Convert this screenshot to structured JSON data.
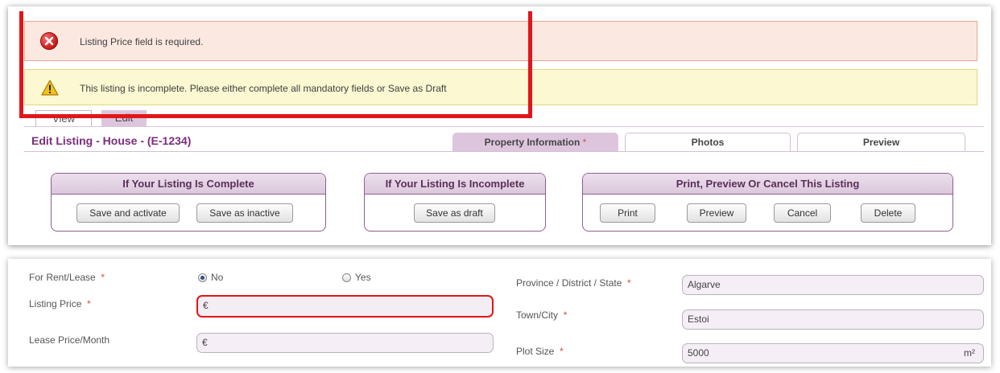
{
  "alerts": {
    "error": "Listing Price field is required.",
    "warning": "This listing is incomplete. Please either complete all mandatory fields or Save as Draft"
  },
  "mode_tabs": [
    "View",
    "Edit"
  ],
  "page_title": "Edit Listing - House - (E-1234)",
  "section_tabs": [
    {
      "label": "Property Information",
      "required": "*"
    },
    {
      "label": "Photos"
    },
    {
      "label": "Preview"
    }
  ],
  "groups": [
    {
      "title": "If Your Listing Is Complete",
      "buttons": [
        "Save and activate",
        "Save as inactive"
      ]
    },
    {
      "title": "If Your Listing Is Incomplete",
      "buttons": [
        "Save as draft"
      ]
    },
    {
      "title": "Print, Preview Or Cancel This Listing",
      "buttons": [
        "Print",
        "Preview",
        "Cancel",
        "Delete"
      ]
    }
  ],
  "form": {
    "rent_label": "For Rent/Lease",
    "rent_options": [
      "No",
      "Yes"
    ],
    "rent_selected": "No",
    "listing_price_label": "Listing Price",
    "listing_price_prefix": "€",
    "lease_price_label": "Lease Price/Month",
    "lease_price_prefix": "€",
    "province_label": "Province / District / State",
    "province_value": "Algarve",
    "town_label": "Town/City",
    "town_value": "Estoi",
    "plot_label": "Plot Size",
    "plot_value": "5000",
    "plot_unit": "m²",
    "required_mark": "*"
  },
  "colors": {
    "accent": "#7b2d7b",
    "tab_active": "#ddc6dd",
    "error_bg": "#fbe9e1",
    "warn_bg": "#fbf8d2",
    "highlight_red": "#e0161a"
  }
}
